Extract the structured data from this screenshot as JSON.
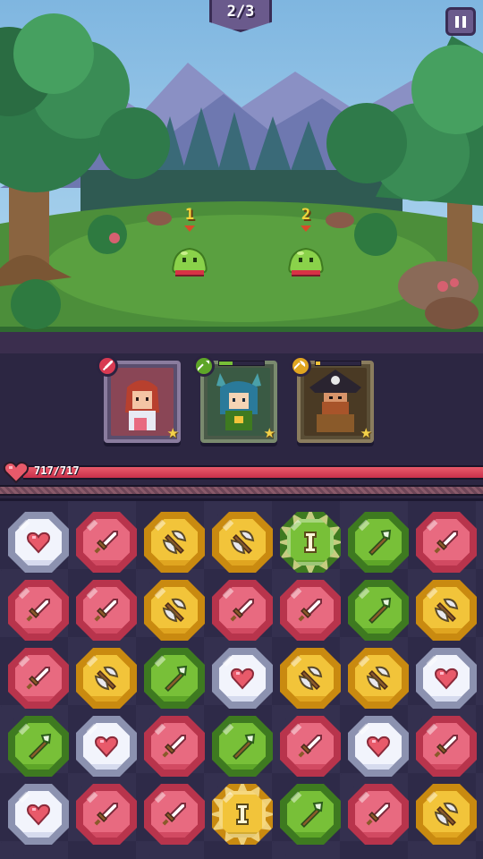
{
  "wave": {
    "label": "2/3"
  },
  "enemies": [
    {
      "number": "1",
      "icon": "green-slime-icon"
    },
    {
      "number": "2",
      "icon": "green-slime-icon"
    }
  ],
  "heroes": [
    {
      "name": "sword-hero",
      "class_icon": "sword-icon",
      "badge_color": "#d83a52",
      "skill_fill": 0,
      "skill_color": "#e86a80",
      "portrait_icon": "red-haired-girl-icon",
      "star": "★"
    },
    {
      "name": "spear-hero",
      "class_icon": "spear-icon",
      "badge_color": "#5ea628",
      "skill_fill": 0.3,
      "skill_color": "#78c038",
      "portrait_icon": "blue-haired-cat-girl-icon",
      "star": "★"
    },
    {
      "name": "axe-hero",
      "class_icon": "axe-icon",
      "badge_color": "#e0a520",
      "skill_fill": 0.1,
      "skill_color": "#f2c43a",
      "portrait_icon": "pirate-captain-icon",
      "star": "★"
    }
  ],
  "player": {
    "hp_text": "717/717",
    "hp_fraction": 1.0
  },
  "board": {
    "columns": 7,
    "rows": [
      [
        "heart",
        "sword",
        "axe",
        "axe",
        "spear-special",
        "spear",
        "sword"
      ],
      [
        "sword",
        "sword",
        "axe",
        "sword",
        "sword",
        "spear",
        "axe"
      ],
      [
        "sword",
        "axe",
        "spear",
        "heart",
        "axe",
        "axe",
        "heart"
      ],
      [
        "spear",
        "heart",
        "sword",
        "spear",
        "sword",
        "heart",
        "sword"
      ],
      [
        "heart",
        "sword",
        "sword",
        "axe-special",
        "spear",
        "sword",
        "axe"
      ]
    ]
  },
  "colors": {
    "sword": "pink",
    "axe": "yellow",
    "spear": "green",
    "heart": "white"
  }
}
